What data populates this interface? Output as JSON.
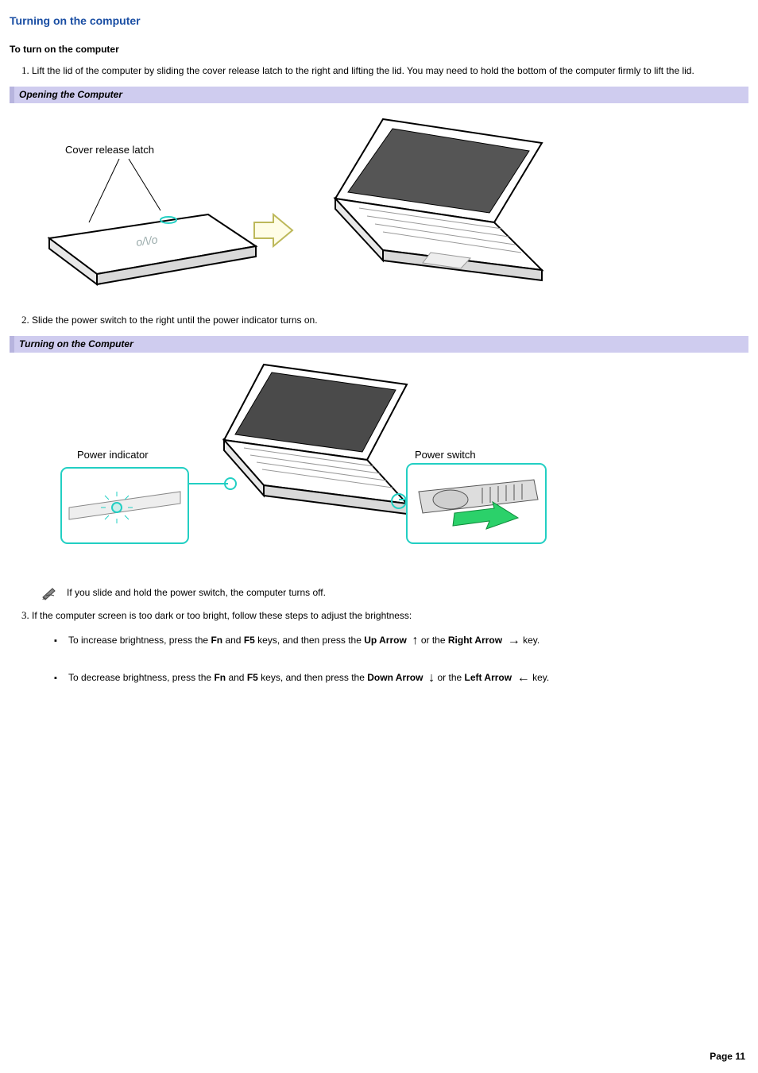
{
  "title": "Turning on the computer",
  "sub_heading": "To turn on the computer",
  "steps": {
    "s1": "Lift the lid of the computer by sliding the cover release latch to the right and lifting the lid. You may need to hold the bottom of the computer firmly to lift the lid.",
    "s2": "Slide the power switch to the right until the power indicator turns on.",
    "s3": "If the computer screen is too dark or too bright, follow these steps to adjust the brightness:"
  },
  "captions": {
    "c1": "Opening the Computer",
    "c2": "Turning on the Computer"
  },
  "fig1_labels": {
    "cover_release_latch": "Cover release latch"
  },
  "fig2_labels": {
    "power_indicator": "Power indicator",
    "power_switch": "Power switch"
  },
  "note": "If you slide and hold the power switch, the computer turns off.",
  "bullets": {
    "inc_pre": "To increase brightness, press the ",
    "fn": "Fn",
    "and": " and ",
    "f5": "F5",
    "inc_mid": " keys, and then press the ",
    "up_arrow": "Up Arrow",
    "or_the": " or the ",
    "right_arrow": "Right Arrow",
    "key_suffix": " key.",
    "dec_pre": "To decrease brightness, press the ",
    "down_arrow": "Down Arrow",
    "left_arrow": "Left Arrow"
  },
  "footer": "Page 11"
}
